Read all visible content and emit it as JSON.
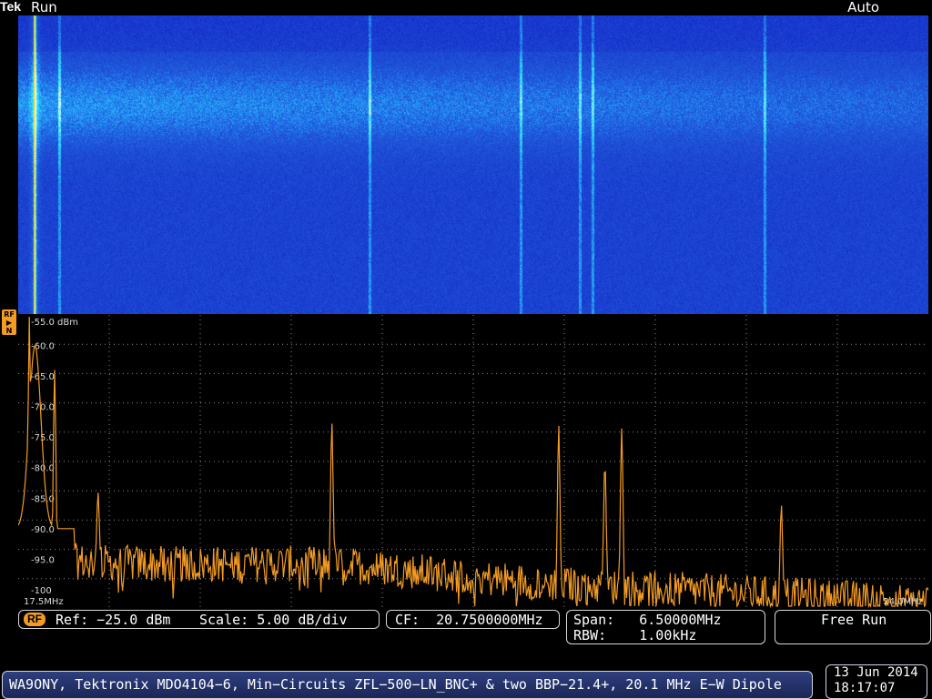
{
  "header": {
    "brand": "Tek",
    "run_state": "Run",
    "trigger_mode": "Auto"
  },
  "waterfall": {
    "description_colors": [
      "#1b36d6",
      "#2e7dff",
      "#37d6ff",
      "#ffffff"
    ]
  },
  "spectrum": {
    "marker_label": "RF",
    "ref_level_label": "-55.0 dBm",
    "y_ticks": [
      "-60.0",
      "-65.0",
      "-70.0",
      "-75.0",
      "-80.0",
      "-85.0",
      "-90.0",
      "-95.0",
      "-100"
    ],
    "start_label": "17.5MHz",
    "stop_label": "24.0MHz",
    "trace_color": "#f39b23"
  },
  "settings": {
    "rf_tag": "RF",
    "ref": "Ref: −25.0 dBm",
    "scale": "Scale: 5.00 dB/div",
    "cf": "CF:  20.7500000MHz",
    "span": "Span:   6.50000MHz",
    "rbw": "RBW:    1.00kHz",
    "mode": "Free Run"
  },
  "footer": {
    "caption": "WA9ONY, Tektronix MDO4104−6, Min−Circuits ZFL−500−LN_BNC+ & two BBP−21.4+, 20.1 MHz E−W Dipole",
    "date": "13 Jun 2014",
    "time": "18:17:07"
  },
  "chart_data": {
    "type": "line",
    "title": "",
    "xlabel": "",
    "ylabel": "",
    "xlim": [
      17.5,
      24.0
    ],
    "ylim": [
      -103,
      -55
    ],
    "y_unit": "dBm",
    "peaks_mhz": [
      {
        "x": 17.58,
        "y": -55.0
      },
      {
        "x": 17.76,
        "y": -64.0
      },
      {
        "x": 18.07,
        "y": -84.0
      },
      {
        "x": 19.74,
        "y": -72.5
      },
      {
        "x": 21.36,
        "y": -73.0
      },
      {
        "x": 21.69,
        "y": -79.0
      },
      {
        "x": 21.81,
        "y": -73.5
      },
      {
        "x": 22.95,
        "y": -86.0
      }
    ],
    "noise_floor_start": -95,
    "noise_floor_end": -102
  }
}
